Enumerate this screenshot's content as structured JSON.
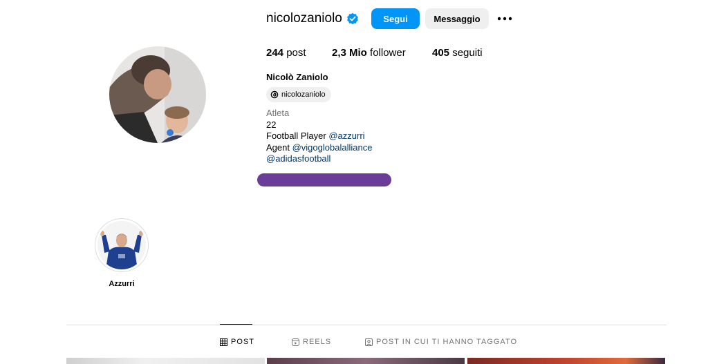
{
  "profile": {
    "username": "nicolozaniolo",
    "verified_icon": "verified-badge-icon",
    "follow_label": "Segui",
    "message_label": "Messaggio",
    "more_icon": "more-options-icon"
  },
  "stats": {
    "posts_value": "244",
    "posts_label": "post",
    "followers_value": "2,3 Mio",
    "followers_label": "follower",
    "following_value": "405",
    "following_label": "seguiti"
  },
  "bio": {
    "full_name": "Nicolò Zaniolo",
    "threads_handle": "nicolozaniolo",
    "category": "Atleta",
    "line_number": "22",
    "football_text": "Football Player ",
    "football_mention": "@azzurri",
    "agent_text": "Agent ",
    "agent_mention": "@vigoglobalalliance",
    "sponsor_mention": "@adidasfootball"
  },
  "highlights": [
    {
      "label": "Azzurri"
    }
  ],
  "tabs": {
    "posts": "POST",
    "reels": "REELS",
    "tagged": "POST IN CUI TI HANNO TAGGATO"
  },
  "colors": {
    "accent": "#0095f6",
    "link": "#00376b",
    "secondary_text": "#737373",
    "button_secondary": "#efefef",
    "redaction": "#6a3d98"
  }
}
